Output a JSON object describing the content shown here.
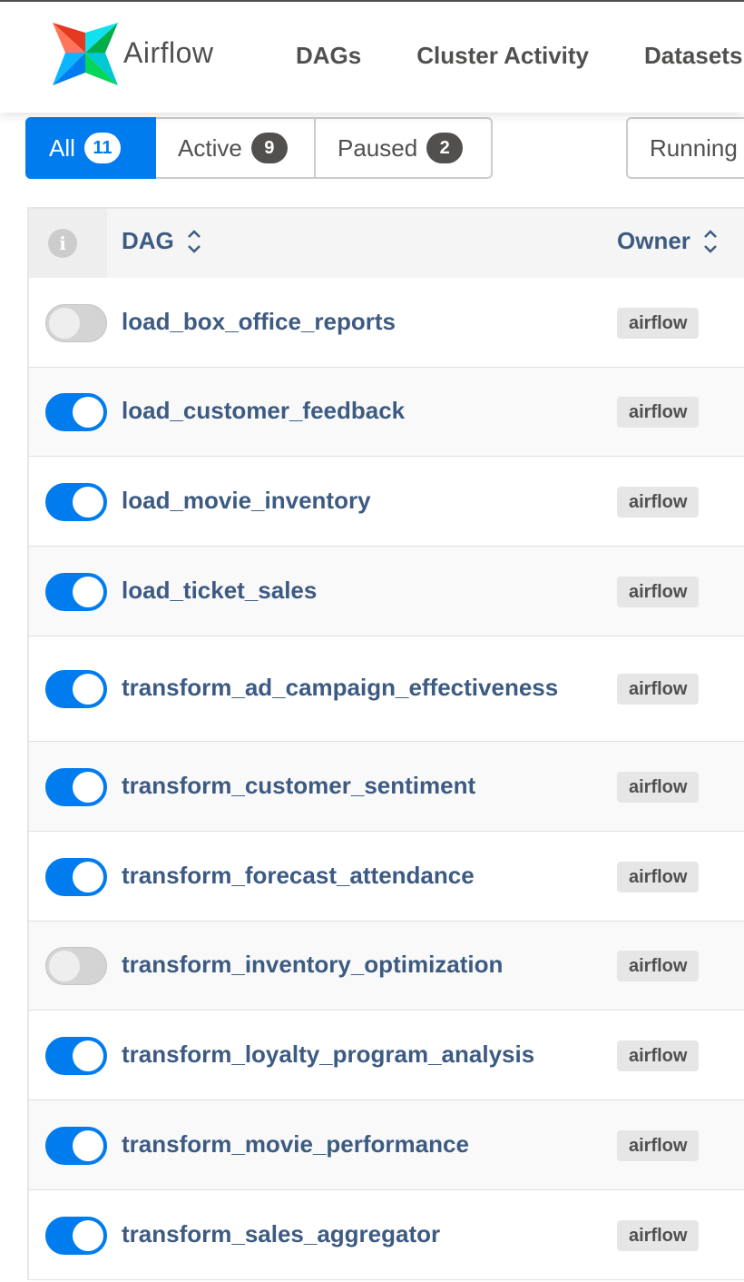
{
  "navbar": {
    "brand": "Airflow",
    "links": [
      "DAGs",
      "Cluster Activity",
      "Datasets"
    ]
  },
  "filters": {
    "all": {
      "label": "All",
      "count": "11"
    },
    "active": {
      "label": "Active",
      "count": "9"
    },
    "paused": {
      "label": "Paused",
      "count": "2"
    },
    "running": "Running"
  },
  "table": {
    "headers": {
      "dag": "DAG",
      "owner": "Owner"
    },
    "rows": [
      {
        "dag_id": "load_box_office_reports",
        "owner": "airflow",
        "enabled": false
      },
      {
        "dag_id": "load_customer_feedback",
        "owner": "airflow",
        "enabled": true
      },
      {
        "dag_id": "load_movie_inventory",
        "owner": "airflow",
        "enabled": true
      },
      {
        "dag_id": "load_ticket_sales",
        "owner": "airflow",
        "enabled": true
      },
      {
        "dag_id": "transform_ad_campaign_effectiveness",
        "owner": "airflow",
        "enabled": true
      },
      {
        "dag_id": "transform_customer_sentiment",
        "owner": "airflow",
        "enabled": true
      },
      {
        "dag_id": "transform_forecast_attendance",
        "owner": "airflow",
        "enabled": true
      },
      {
        "dag_id": "transform_inventory_optimization",
        "owner": "airflow",
        "enabled": false
      },
      {
        "dag_id": "transform_loyalty_program_analysis",
        "owner": "airflow",
        "enabled": true
      },
      {
        "dag_id": "transform_movie_performance",
        "owner": "airflow",
        "enabled": true
      },
      {
        "dag_id": "transform_sales_aggregator",
        "owner": "airflow",
        "enabled": true
      }
    ]
  },
  "colors": {
    "accent": "#017cee",
    "link": "#3d5b82",
    "text": "#51504f"
  }
}
